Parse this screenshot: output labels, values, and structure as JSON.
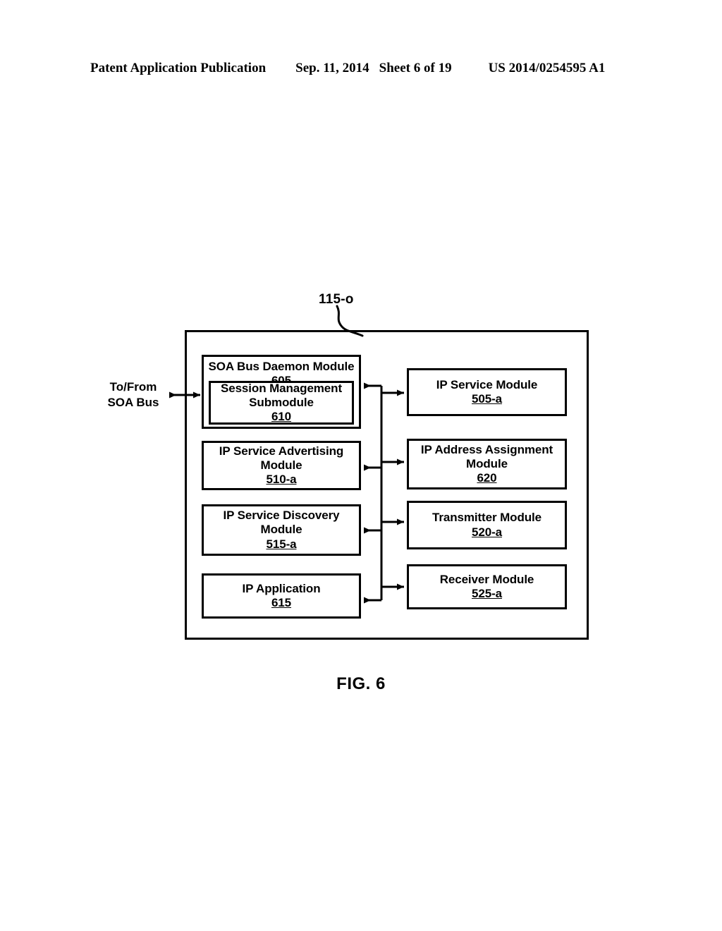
{
  "header": {
    "publication": "Patent Application Publication",
    "date": "Sep. 11, 2014",
    "sheet": "Sheet 6 of 19",
    "patent_number": "US 2014/0254595 A1"
  },
  "figure": {
    "caption": "FIG. 6",
    "enclosure_reference": "115-o",
    "external_port_label": "To/From\nSOA Bus",
    "external_port_line1": "To/From",
    "external_port_line2": "SOA Bus"
  },
  "left_column": [
    {
      "title": "SOA Bus Daemon Module",
      "ref": "605",
      "submodule": {
        "title_line1": "Session Management",
        "title_line2": "Submodule",
        "ref": "610"
      }
    },
    {
      "title_line1": "IP Service Advertising",
      "title_line2": "Module",
      "ref": "510-a"
    },
    {
      "title_line1": "IP Service Discovery",
      "title_line2": "Module",
      "ref": "515-a"
    },
    {
      "title_line1": "IP Application",
      "ref": "615"
    }
  ],
  "right_column": [
    {
      "title_line1": "IP Service Module",
      "ref": "505-a"
    },
    {
      "title_line1": "IP Address Assignment",
      "title_line2": "Module",
      "ref": "620"
    },
    {
      "title_line1": "Transmitter Module",
      "ref": "520-a"
    },
    {
      "title_line1": "Receiver Module",
      "ref": "525-a"
    }
  ],
  "colors": {
    "stroke": "#000000",
    "background": "#ffffff"
  }
}
